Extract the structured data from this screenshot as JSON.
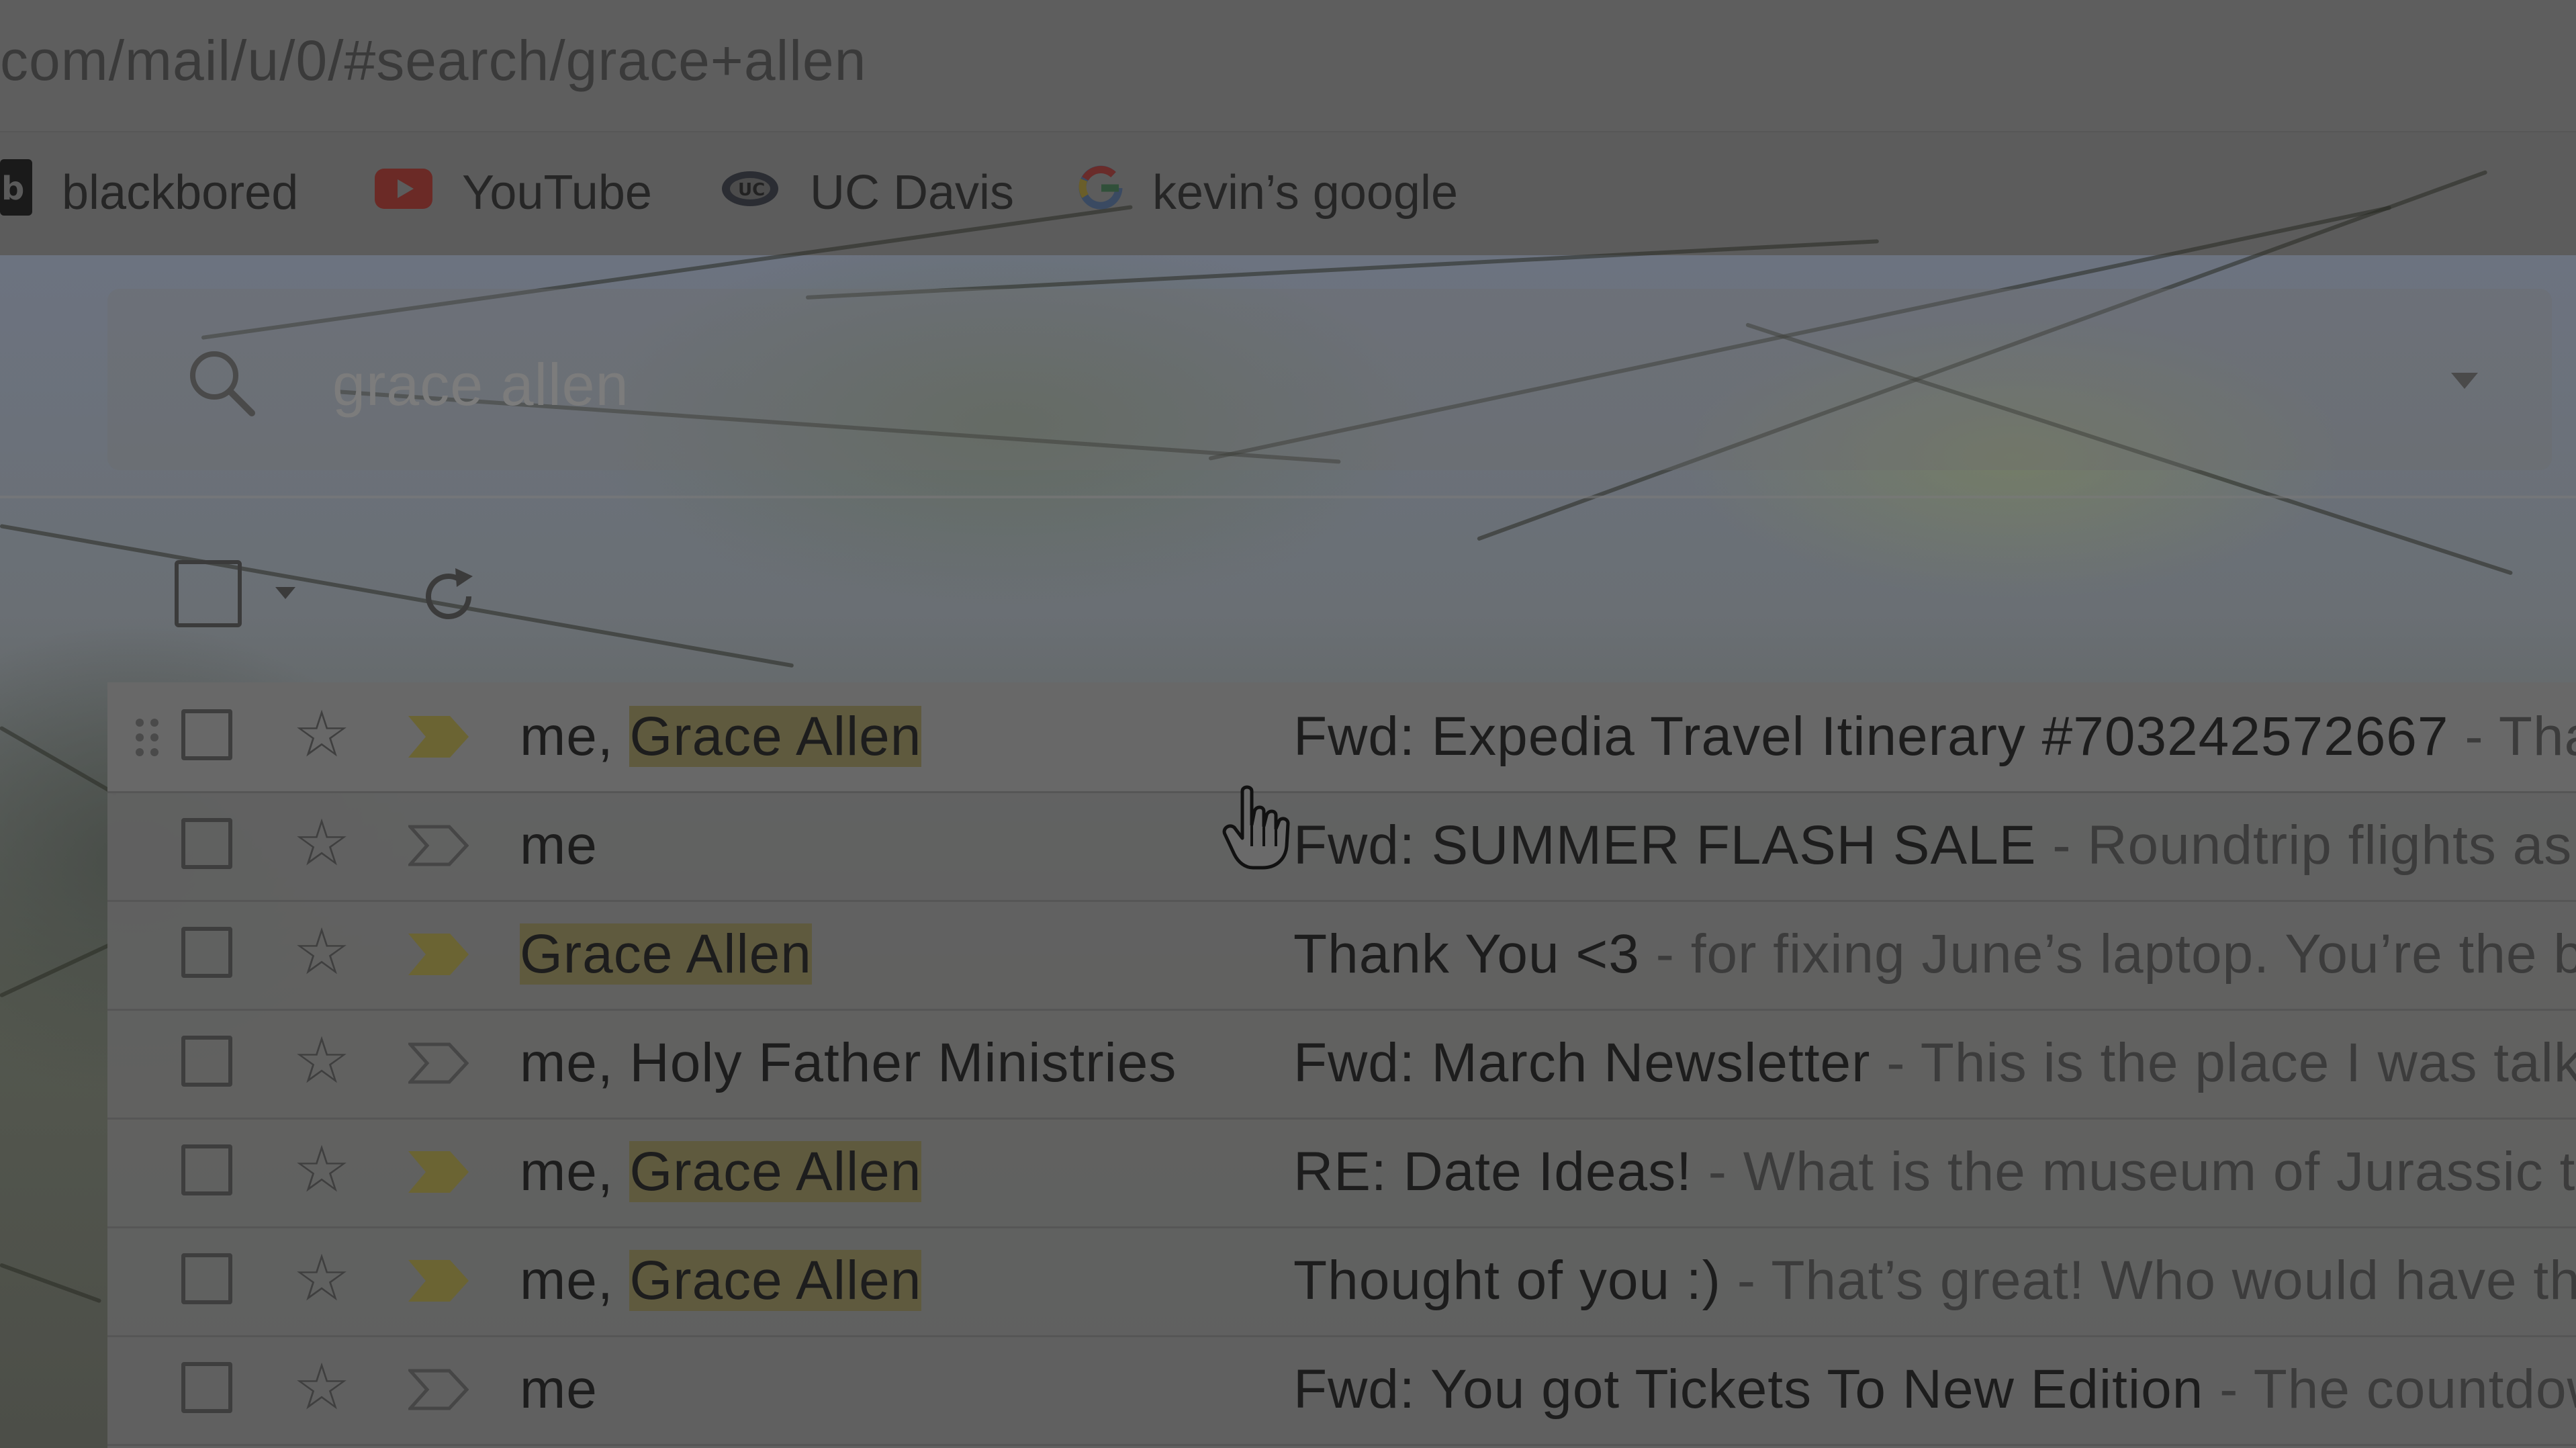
{
  "browser": {
    "url_prefix": "com",
    "url_path": "/mail/u/0/#search/grace+allen",
    "bookmarks": [
      {
        "icon": "blackboard-icon",
        "label": "blackbored"
      },
      {
        "icon": "youtube-icon",
        "label": "YouTube"
      },
      {
        "icon": "uc-davis-icon",
        "label": "UC Davis"
      },
      {
        "icon": "google-icon",
        "label": "kevin’s google"
      }
    ]
  },
  "search": {
    "query": "grace allen",
    "icon": "search-icon"
  },
  "toolbar": {
    "icons": [
      "select-all-checkbox",
      "select-dropdown-icon",
      "refresh-icon"
    ]
  },
  "emails": [
    {
      "sender_prefix": "me, ",
      "sender_highlight": "Grace Allen",
      "subject": "Fwd: Expedia Travel Itinerary #703242572667",
      "snippet": " - Thar",
      "important": true
    },
    {
      "sender_prefix": "me",
      "sender_highlight": "",
      "subject": "Fwd: SUMMER FLASH SALE",
      "snippet": " - Roundtrip flights as lo",
      "important": false
    },
    {
      "sender_prefix": "",
      "sender_highlight": "Grace Allen",
      "subject": "Thank You <3",
      "snippet": " - for fixing June’s laptop. You’re the be",
      "important": true
    },
    {
      "sender_prefix": "me, Holy Father Ministries",
      "sender_highlight": "",
      "subject": "Fwd: March Newsletter",
      "snippet": " - This is the place I was talki",
      "important": false
    },
    {
      "sender_prefix": "me, ",
      "sender_highlight": "Grace Allen",
      "subject": "RE: Date Ideas!",
      "snippet": " - What is the museum of Jurassic te",
      "important": true
    },
    {
      "sender_prefix": "me, ",
      "sender_highlight": "Grace Allen",
      "subject": "Thought of you :)",
      "snippet": " - That’s great! Who would have tho",
      "important": true
    },
    {
      "sender_prefix": "me",
      "sender_highlight": "",
      "subject": "Fwd: You got Tickets To New Edition",
      "snippet": " - The countdow",
      "important": false
    }
  ],
  "colors": {
    "important_marker": "#6b6433",
    "highlight": "#5f5a3e"
  }
}
